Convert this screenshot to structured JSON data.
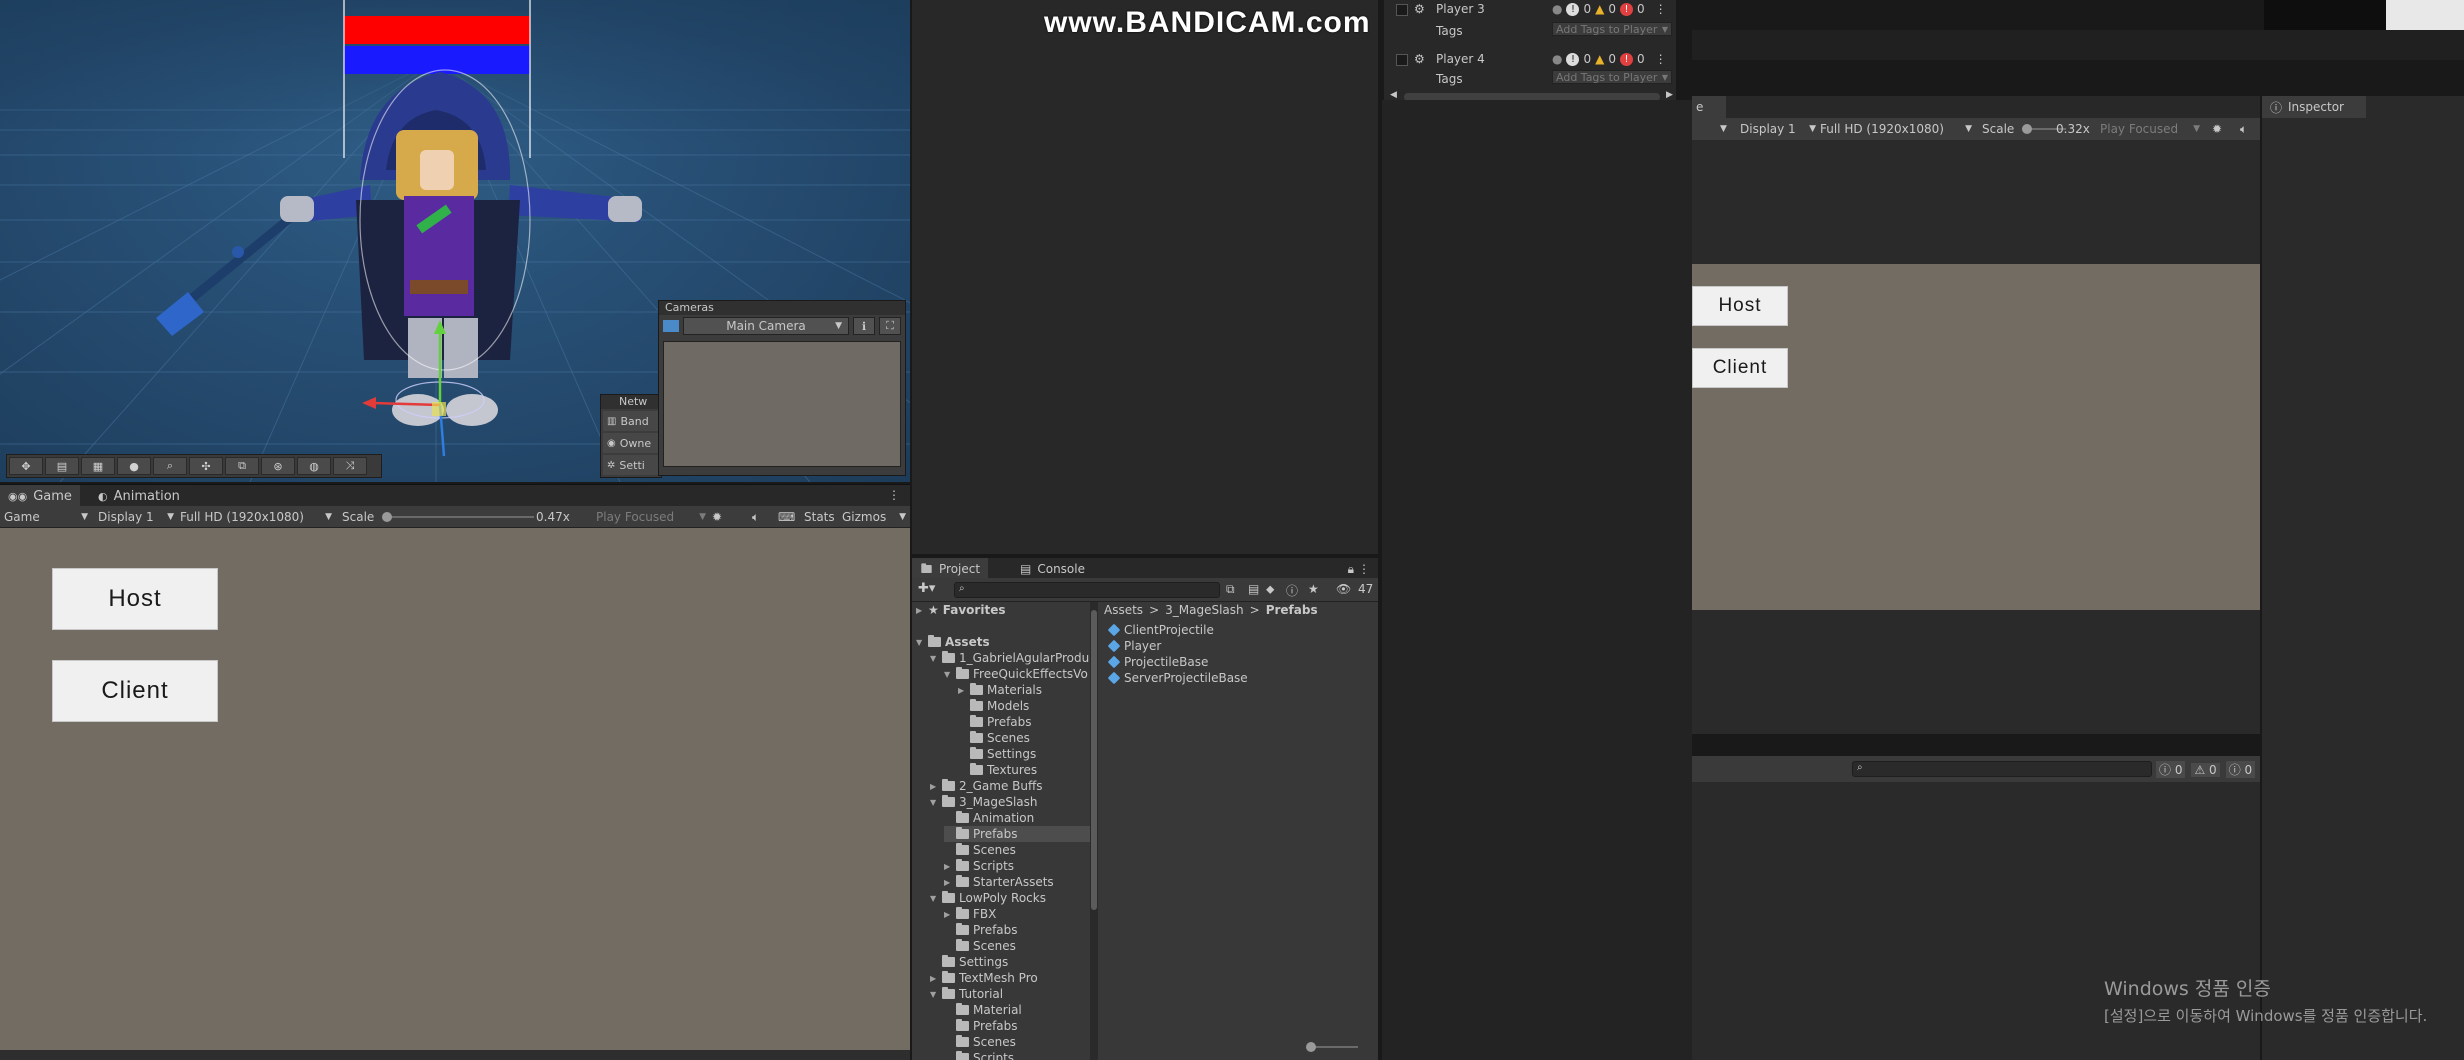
{
  "watermark": "www.BANDICAM.com",
  "scene": {
    "cameras_title": "Cameras",
    "camera_select": "Main Camera",
    "network_title": "Netw",
    "network_items": [
      "Band",
      "Owne",
      "Setti"
    ]
  },
  "game_tabs": {
    "game": "Game",
    "animation": "Animation"
  },
  "game_toolbar": {
    "mode": "Game",
    "display": "Display 1",
    "resolution": "Full HD (1920x1080)",
    "scale_label": "Scale",
    "scale_value": "0.47x",
    "play_focused": "Play Focused",
    "stats": "Stats",
    "gizmos": "Gizmos"
  },
  "game_buttons": {
    "host": "Host",
    "client": "Client"
  },
  "hierarchy": {
    "rows": [
      {
        "name": "Player 3",
        "tags_label": "Tags",
        "tags_value": "Add Tags to Player",
        "info": "0",
        "warn": "0",
        "err": "0"
      },
      {
        "name": "Player 4",
        "tags_label": "Tags",
        "tags_value": "Add Tags to Player",
        "info": "0",
        "warn": "0",
        "err": "0"
      }
    ]
  },
  "project": {
    "tabs": {
      "project": "Project",
      "console": "Console"
    },
    "count": "47",
    "favorites": "Favorites",
    "breadcrumb": {
      "root": "Assets",
      "sep": ">",
      "mid": "3_MageSlash",
      "current": "Prefabs"
    },
    "tree": [
      {
        "label": "Assets",
        "indent": 0,
        "open": true,
        "bold": true
      },
      {
        "label": "1_GabrielAgularProduc",
        "indent": 1,
        "open": true
      },
      {
        "label": "FreeQuickEffectsVo",
        "indent": 2,
        "open": true
      },
      {
        "label": "Materials",
        "indent": 3,
        "closed": true
      },
      {
        "label": "Models",
        "indent": 3
      },
      {
        "label": "Prefabs",
        "indent": 3
      },
      {
        "label": "Scenes",
        "indent": 3
      },
      {
        "label": "Settings",
        "indent": 3
      },
      {
        "label": "Textures",
        "indent": 3
      },
      {
        "label": "2_Game Buffs",
        "indent": 1,
        "closed": true
      },
      {
        "label": "3_MageSlash",
        "indent": 1,
        "open": true
      },
      {
        "label": "Animation",
        "indent": 2
      },
      {
        "label": "Prefabs",
        "indent": 2,
        "selected": true
      },
      {
        "label": "Scenes",
        "indent": 2
      },
      {
        "label": "Scripts",
        "indent": 2,
        "closed": true
      },
      {
        "label": "StarterAssets",
        "indent": 2,
        "closed": true
      },
      {
        "label": "LowPoly Rocks",
        "indent": 1,
        "open": true
      },
      {
        "label": "FBX",
        "indent": 2,
        "closed": true
      },
      {
        "label": "Prefabs",
        "indent": 2
      },
      {
        "label": "Scenes",
        "indent": 2
      },
      {
        "label": "Settings",
        "indent": 1
      },
      {
        "label": "TextMesh Pro",
        "indent": 1,
        "closed": true
      },
      {
        "label": "Tutorial",
        "indent": 1,
        "open": true
      },
      {
        "label": "Material",
        "indent": 2
      },
      {
        "label": "Prefabs",
        "indent": 2
      },
      {
        "label": "Scenes",
        "indent": 2
      },
      {
        "label": "Scripts",
        "indent": 2
      }
    ],
    "files": [
      "ClientProjectile",
      "Player",
      "ProjectileBase",
      "ServerProjectileBase"
    ]
  },
  "game2": {
    "tab_partial": "e",
    "display": "Display 1",
    "resolution": "Full HD (1920x1080)",
    "scale_label": "Scale",
    "scale_value": "0.32x",
    "play_focused": "Play Focused",
    "host": "Host",
    "client": "Client",
    "console_counts": [
      "0",
      "0",
      "0"
    ]
  },
  "inspector": {
    "title": "Inspector"
  },
  "windows_activation": {
    "line1": "Windows 정품 인증",
    "line2": "[설정]으로 이동하여 Windows를 정품 인증합니다."
  },
  "colors": {
    "game_bg": "#736c63",
    "scene_bg": "#264d72",
    "host_button_bg": "#f0f0f0"
  }
}
